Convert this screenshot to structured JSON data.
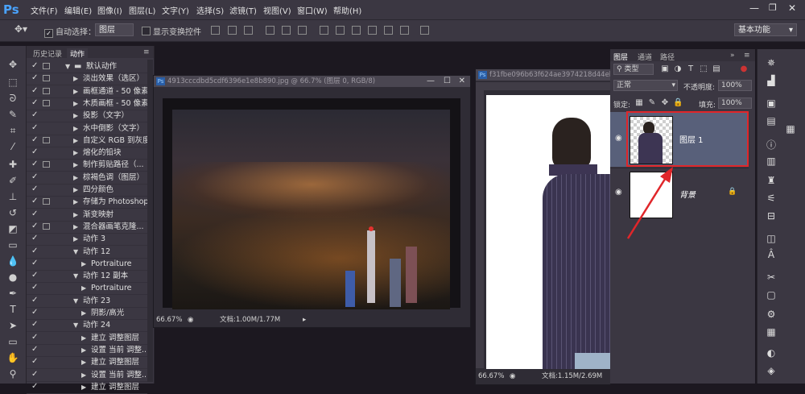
{
  "app": {
    "logo": "Ps"
  },
  "menu": [
    "文件(F)",
    "编辑(E)",
    "图像(I)",
    "图层(L)",
    "文字(Y)",
    "选择(S)",
    "滤镜(T)",
    "视图(V)",
    "窗口(W)",
    "帮助(H)"
  ],
  "options": {
    "auto_select_label": "自动选择：",
    "auto_select_value": "图层",
    "show_transform_label": "显示变换控件",
    "workspace": "基本功能"
  },
  "actions_panel": {
    "tabs": [
      "历史记录",
      "动作"
    ],
    "rows": [
      {
        "label": "默认动作",
        "level": 0,
        "expanded": true,
        "folder": true,
        "dialog": true
      },
      {
        "label": "淡出效果（选区）",
        "level": 1,
        "expanded": false,
        "dialog": true
      },
      {
        "label": "画框通道 - 50 像素",
        "level": 1,
        "expanded": false,
        "dialog": true
      },
      {
        "label": "木质画框 - 50 像素",
        "level": 1,
        "expanded": false,
        "dialog": true
      },
      {
        "label": "投影（文字）",
        "level": 1,
        "expanded": false,
        "dialog": false
      },
      {
        "label": "水中倒影（文字）",
        "level": 1,
        "expanded": false,
        "dialog": false
      },
      {
        "label": "自定义 RGB 到灰度",
        "level": 1,
        "expanded": false,
        "dialog": true
      },
      {
        "label": "熔化的铅块",
        "level": 1,
        "expanded": false,
        "dialog": false
      },
      {
        "label": "制作剪贴路径（...",
        "level": 1,
        "expanded": false,
        "dialog": true
      },
      {
        "label": "棕褐色调（图层）",
        "level": 1,
        "expanded": false,
        "dialog": false
      },
      {
        "label": "四分颜色",
        "level": 1,
        "expanded": false,
        "dialog": false
      },
      {
        "label": "存储为 Photoshop...",
        "level": 1,
        "expanded": false,
        "dialog": true
      },
      {
        "label": "渐变映射",
        "level": 1,
        "expanded": false,
        "dialog": false
      },
      {
        "label": "混合器画笔克隆...",
        "level": 1,
        "expanded": false,
        "dialog": true
      },
      {
        "label": "动作 3",
        "level": 1,
        "expanded": false,
        "dialog": false
      },
      {
        "label": "动作 12",
        "level": 1,
        "expanded": true,
        "dialog": false
      },
      {
        "label": "Portraiture",
        "level": 2,
        "expanded": false,
        "dialog": false
      },
      {
        "label": "动作 12 副本",
        "level": 1,
        "expanded": true,
        "dialog": false
      },
      {
        "label": "Portraiture",
        "level": 2,
        "expanded": false,
        "dialog": false
      },
      {
        "label": "动作 23",
        "level": 1,
        "expanded": true,
        "dialog": false
      },
      {
        "label": "阴影/高光",
        "level": 2,
        "expanded": false,
        "dialog": false
      },
      {
        "label": "动作 24",
        "level": 1,
        "expanded": true,
        "dialog": false
      },
      {
        "label": "建立 调整图层",
        "level": 2,
        "expanded": false,
        "dialog": false
      },
      {
        "label": "设置 当前 调整...",
        "level": 2,
        "expanded": false,
        "dialog": false
      },
      {
        "label": "建立 调整图层",
        "level": 2,
        "expanded": false,
        "dialog": false
      },
      {
        "label": "设置 当前 调整...",
        "level": 2,
        "expanded": false,
        "dialog": false
      },
      {
        "label": "建立 调整图层",
        "level": 2,
        "expanded": false,
        "dialog": false
      }
    ]
  },
  "doc1": {
    "title": "4913cccdbd5cdf6396e1e8b890.jpg @ 66.7% (图层 0, RGB/8)",
    "zoom": "66.67%",
    "doc_info": "文档:1.00M/1.77M"
  },
  "doc2": {
    "title": "f31fbe096b63f624ae3974218d44eb",
    "zoom": "66.67%",
    "doc_info": "文档:1.15M/2.69M"
  },
  "layers_panel": {
    "tabs": [
      "图层",
      "通道",
      "路径"
    ],
    "filter_kind": "类型",
    "blend_mode": "正常",
    "opacity_label": "不透明度:",
    "opacity": "100%",
    "lock_label": "锁定:",
    "fill_label": "填充:",
    "fill": "100%",
    "layers": [
      {
        "name": "图层 1",
        "selected": true
      },
      {
        "name": "背景",
        "selected": false,
        "locked": true
      }
    ]
  },
  "colors": {
    "highlight": "#e0262a",
    "ps_blue": "#4aa3ff",
    "panel": "#3b3742"
  }
}
